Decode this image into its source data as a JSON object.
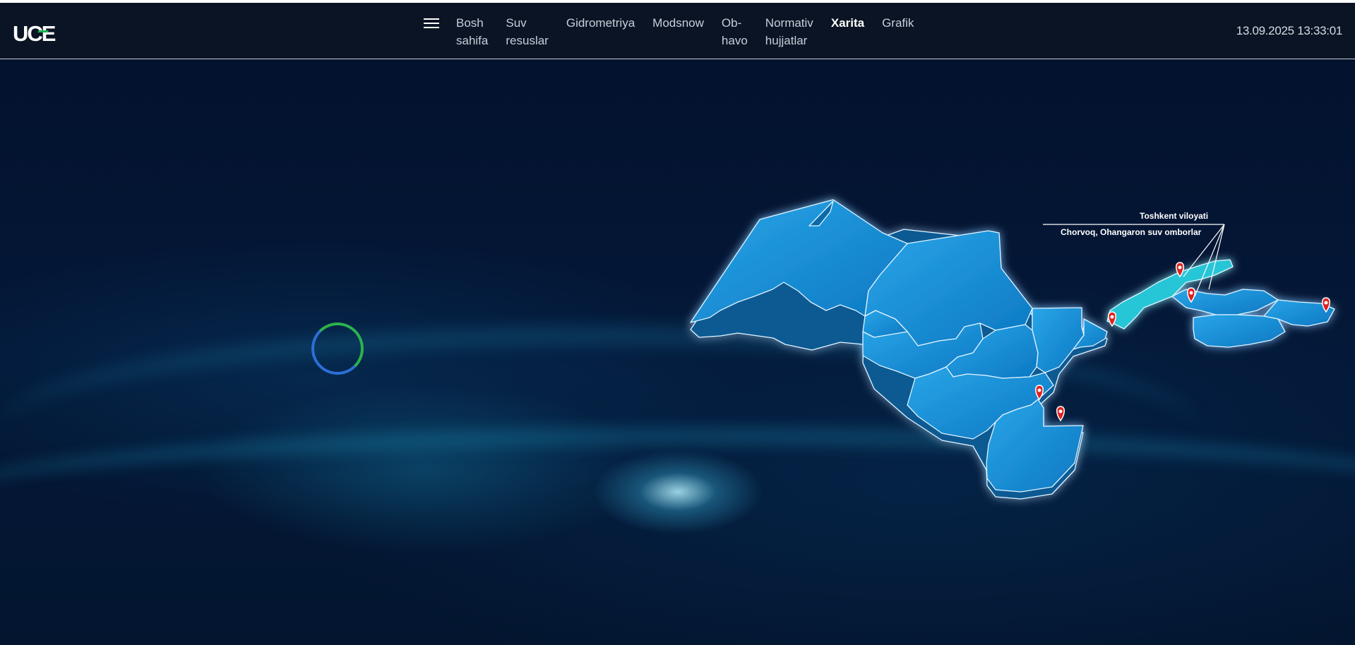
{
  "app": {
    "logo_text": "UCE",
    "menu_icon": "hamburger-menu-icon"
  },
  "nav": {
    "items": [
      {
        "label": "Bosh\nsahifa",
        "active": false
      },
      {
        "label": "Suv\nresuslar",
        "active": false
      },
      {
        "label": "Gidrometriya",
        "active": false
      },
      {
        "label": "Modsnow",
        "active": false
      },
      {
        "label": "Ob-\nhavo",
        "active": false
      },
      {
        "label": "Normativ\nhujjatlar",
        "active": false
      },
      {
        "label": "Xarita",
        "active": true
      },
      {
        "label": "Grafik",
        "active": false
      }
    ]
  },
  "header": {
    "datetime": "13.09.2025 13:33:01"
  },
  "map": {
    "highlighted_region": "Toshkent viloyati",
    "callout_subtitle": "Chorvoq, Ohangaron suv omborlar",
    "region_color": "#1593d6",
    "highlight_color": "#25c6d6",
    "marker_color": "#e0201e",
    "marker_icon": "map-pin-icon",
    "loading_icon": "loading-spinner-icon"
  },
  "colors": {
    "header_bg": "#0b1424",
    "background": "#03122e",
    "accent_green": "#19b34c"
  }
}
